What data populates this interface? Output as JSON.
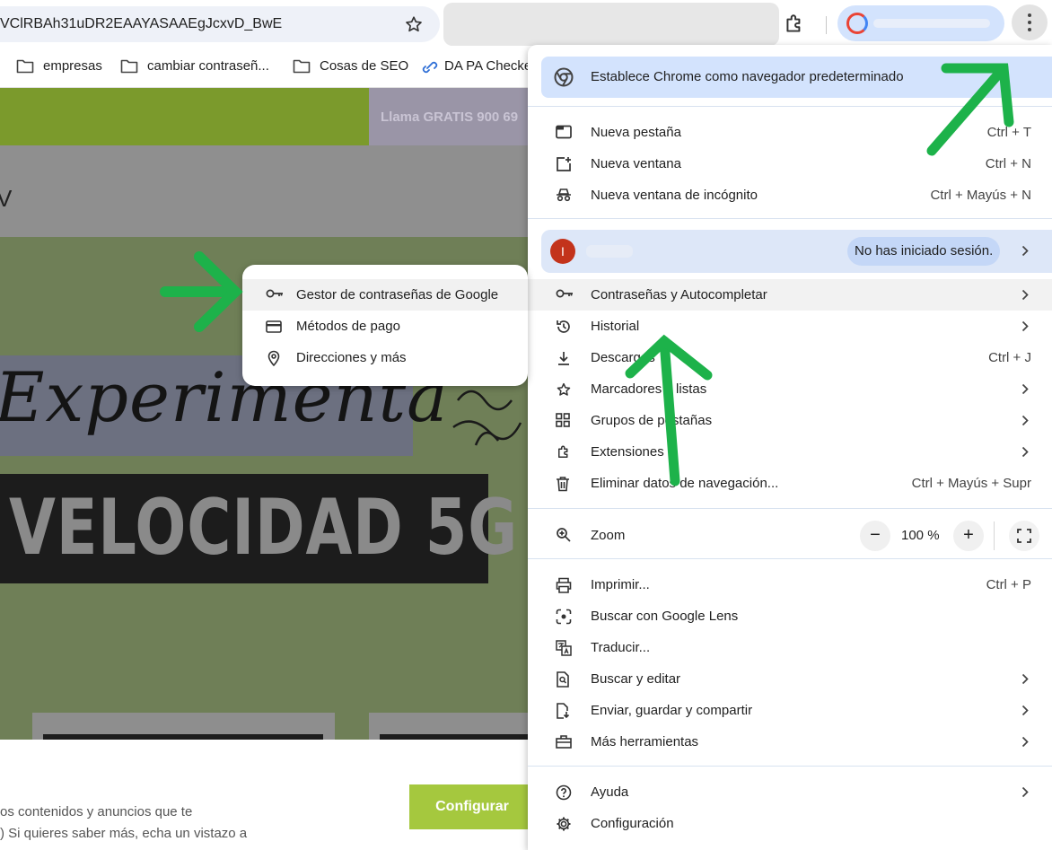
{
  "toolbar": {
    "url": "VClRBAh31uDR2EAAYASAAEgJcxvD_BwE"
  },
  "bookmarks": [
    {
      "label": "empresas",
      "icon": "folder-icon"
    },
    {
      "label": "cambiar contraseñ...",
      "icon": "folder-icon"
    },
    {
      "label": "Cosas de SEO",
      "icon": "folder-icon"
    },
    {
      "label": "DA PA Checke",
      "icon": "link-icon"
    }
  ],
  "page": {
    "top_banner_text": "Llama GRATIS 900 69",
    "header_glyph": "V",
    "hero_script": "Experimenta",
    "hero_title": "VELOCIDAD 5G",
    "cookie_lines": [
      "os contenidos y anuncios que te",
      ") Si quieres saber más, echa un vistazo a"
    ],
    "configure_button": "Configurar"
  },
  "submenu": {
    "items": [
      {
        "label": "Gestor de contraseñas de Google",
        "icon": "key-icon"
      },
      {
        "label": "Métodos de pago",
        "icon": "credit-card-icon"
      },
      {
        "label": "Direcciones y más",
        "icon": "location-pin-icon"
      }
    ]
  },
  "menu": {
    "banner": "Establece Chrome como navegador predeterminado",
    "group1": [
      {
        "label": "Nueva pestaña",
        "shortcut": "Ctrl + T",
        "icon": "new-tab-icon"
      },
      {
        "label": "Nueva ventana",
        "shortcut": "Ctrl + N",
        "icon": "new-window-icon"
      },
      {
        "label": "Nueva ventana de incógnito",
        "shortcut": "Ctrl + Mayús + N",
        "icon": "incognito-icon"
      }
    ],
    "account": {
      "avatar_letter": "I",
      "status": "No has iniciado sesión."
    },
    "group2": [
      {
        "label": "Contraseñas y Autocompletar",
        "icon": "key-icon"
      },
      {
        "label": "Historial",
        "icon": "history-icon"
      },
      {
        "label": "Descargas",
        "shortcut": "Ctrl + J",
        "icon": "download-icon"
      },
      {
        "label": "Marcadores y listas",
        "icon": "star-icon"
      },
      {
        "label": "Grupos de pestañas",
        "icon": "tab-groups-icon"
      },
      {
        "label": "Extensiones",
        "icon": "extensions-icon"
      },
      {
        "label": "Eliminar datos de navegación...",
        "shortcut": "Ctrl + Mayús + Supr",
        "icon": "trash-icon"
      }
    ],
    "zoom": {
      "label": "Zoom",
      "minus": "−",
      "value": "100 %",
      "plus": "+"
    },
    "group3": [
      {
        "label": "Imprimir...",
        "shortcut": "Ctrl + P",
        "icon": "print-icon"
      },
      {
        "label": "Buscar con Google Lens",
        "icon": "google-lens-icon"
      },
      {
        "label": "Traducir...",
        "icon": "translate-icon"
      },
      {
        "label": "Buscar y editar",
        "icon": "find-icon"
      },
      {
        "label": "Enviar, guardar y compartir",
        "icon": "share-icon"
      },
      {
        "label": "Más herramientas",
        "icon": "toolbox-icon"
      }
    ],
    "group4": [
      {
        "label": "Ayuda",
        "icon": "help-icon"
      },
      {
        "label": "Configuración",
        "icon": "settings-icon"
      }
    ]
  },
  "colors": {
    "annotation_arrow": "#1db24a",
    "banner_bg": "#d3e3fd",
    "configure_button": "#a5c83e"
  }
}
